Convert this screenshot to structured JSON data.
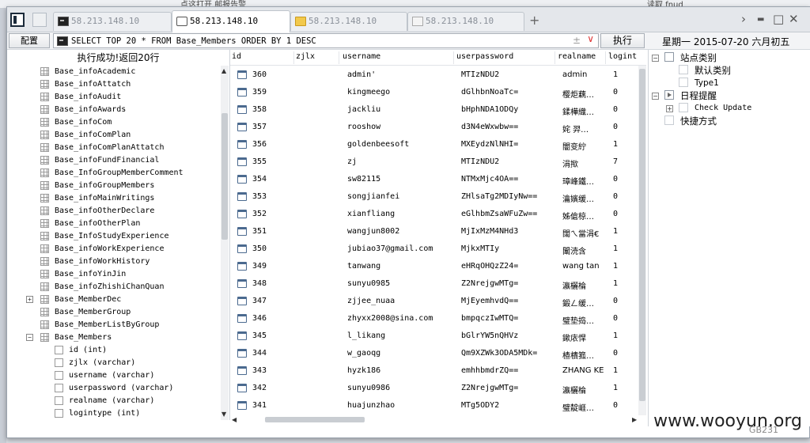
{
  "background_strip": {
    "text1": "点这打开  邮报告警",
    "text2": "读取    fnud"
  },
  "tabs": [
    {
      "label": "58.213.148.10",
      "icon": "terminal-icon",
      "active": false
    },
    {
      "label": "58.213.148.10",
      "icon": "document-icon",
      "active": true
    },
    {
      "label": "58.213.148.10",
      "icon": "folder-icon",
      "active": false
    },
    {
      "label": "58.213.148.10",
      "icon": "document-icon",
      "active": false
    }
  ],
  "tab_controls": {
    "add": "+",
    "arrow": "›",
    "minimize": "▬",
    "maximize": "□",
    "close": "✕"
  },
  "toolbar": {
    "config_label": "配置",
    "sql": "SELECT TOP 20 * FROM Base_Members ORDER BY 1 DESC",
    "sql_plusminus": "±",
    "sql_dropdown": "∨",
    "execute_label": "执行",
    "date": "星期一 2015-07-20 六月初五"
  },
  "left_panel": {
    "status": "执行成功!返回20行",
    "tables": [
      "Base_infoAcademic",
      "Base_infoAttatch",
      "Base_infoAudit",
      "Base_infoAwards",
      "Base_infoCom",
      "Base_infoComPlan",
      "Base_infoComPlanAttatch",
      "Base_infoFundFinancial",
      "Base_InfoGroupMemberComment",
      "Base_infoGroupMembers",
      "Base_infoMainWritings",
      "Base_infoOtherDeclare",
      "Base_infoOtherPlan",
      "Base_InfoStudyExperience",
      "Base_infoWorkExperience",
      "Base_infoWorkHistory",
      "Base_infoYinJin",
      "Base_infoZhishiChanQuan",
      "Base_MemberDec",
      "Base_MemberGroup",
      "Base_MemberListByGroup",
      "Base_Members"
    ],
    "columns": [
      "id (int)",
      "zjlx (varchar)",
      "username (varchar)",
      "userpassword (varchar)",
      "realname (varchar)",
      "logintype (int)"
    ]
  },
  "results": {
    "headers": [
      "id",
      "zjlx",
      "username",
      "userpassword",
      "realname",
      "logint"
    ],
    "rows": [
      {
        "id": "360",
        "username": "admin'",
        "userpassword": "MTIzNDU2",
        "realname": "admin",
        "logintype": "1"
      },
      {
        "id": "359",
        "username": "kingmeego",
        "userpassword": "dGlhbnNoaTc=",
        "realname": "樱炬藕…",
        "logintype": "0"
      },
      {
        "id": "358",
        "username": "jackliu",
        "userpassword": "bHphNDA1ODQy",
        "realname": "鍒樺織…",
        "logintype": "0"
      },
      {
        "id": "357",
        "username": "rooshow",
        "userpassword": "d3N4eWxwbw==",
        "realname": "姹  羿…",
        "logintype": "0"
      },
      {
        "id": "356",
        "username": "goldenbeesoft",
        "userpassword": "MXEydzNlNHI=",
        "realname": "闇变紵",
        "logintype": "1"
      },
      {
        "id": "355",
        "username": "zj",
        "userpassword": "MTIzNDU2",
        "realname": "涓揿",
        "logintype": "7"
      },
      {
        "id": "354",
        "username": "sw82115",
        "userpassword": "NTMxMjc4OA==",
        "realname": "璋峰鐵…",
        "logintype": "0"
      },
      {
        "id": "353",
        "username": "songjianfei",
        "userpassword": "ZHlsaTg2MDIyNw==",
        "realname": "瀹嬪缓…",
        "logintype": "0"
      },
      {
        "id": "352",
        "username": "xianfliang",
        "userpassword": "eGlhbmZsaWFuZw==",
        "realname": "姊傖椋…",
        "logintype": "0"
      },
      {
        "id": "351",
        "username": "wangjun8002",
        "userpassword": "MjIxMzM4NHd3",
        "realname": "闊ㄟ當涓€",
        "logintype": "1"
      },
      {
        "id": "350",
        "username": "jubiao37@gmail.com",
        "userpassword": "MjkxMTIy",
        "realname": "闈涜含",
        "logintype": "1"
      },
      {
        "id": "349",
        "username": "tanwang",
        "userpassword": "eHRqOHQzZ24=",
        "realname": "wang tan",
        "logintype": "1"
      },
      {
        "id": "348",
        "username": "sunyu0985",
        "userpassword": "Z2NrejgwMTg=",
        "realname": "瀛欐棆",
        "logintype": "1"
      },
      {
        "id": "347",
        "username": "zjjee_nuaa",
        "userpassword": "MjEyemhvdQ==",
        "realname": "鍛ㄥ缓…",
        "logintype": "0"
      },
      {
        "id": "346",
        "username": "zhyxx2008@sina.com",
        "userpassword": "bmpqczIwMTQ=",
        "realname": "璧垫捣…",
        "logintype": "0"
      },
      {
        "id": "345",
        "username": "l_likang",
        "userpassword": "bGlrYW5nQHVz",
        "realname": "鏉庡悍",
        "logintype": "1"
      },
      {
        "id": "344",
        "username": "w_gaoqg",
        "userpassword": "Qm9XZWk3ODA5MDk=",
        "realname": "楂樻箛…",
        "logintype": "0"
      },
      {
        "id": "343",
        "username": "hyzk186",
        "userpassword": "emhhbmdrZQ==",
        "realname": "ZHANG KE",
        "logintype": "1"
      },
      {
        "id": "342",
        "username": "sunyu0986",
        "userpassword": "Z2NrejgwMTg=",
        "realname": "瀛欐棆",
        "logintype": "1"
      },
      {
        "id": "341",
        "username": "huajunzhao",
        "userpassword": "MTg5ODY2",
        "realname": "璧靛崕…",
        "logintype": "0"
      }
    ]
  },
  "right_panel": {
    "site_category": "站点类别",
    "default_category": "默认类别",
    "type1": "Type1",
    "schedule": "日程提醒",
    "check_update": "Check Update",
    "shortcut": "快捷方式"
  },
  "watermark": {
    "main": "www.wooyun.org",
    "sub": "GB231"
  },
  "colors": {
    "accent": "#4b6a8f",
    "close_mark": "#d61e1e",
    "folder": "#f2c94c"
  }
}
